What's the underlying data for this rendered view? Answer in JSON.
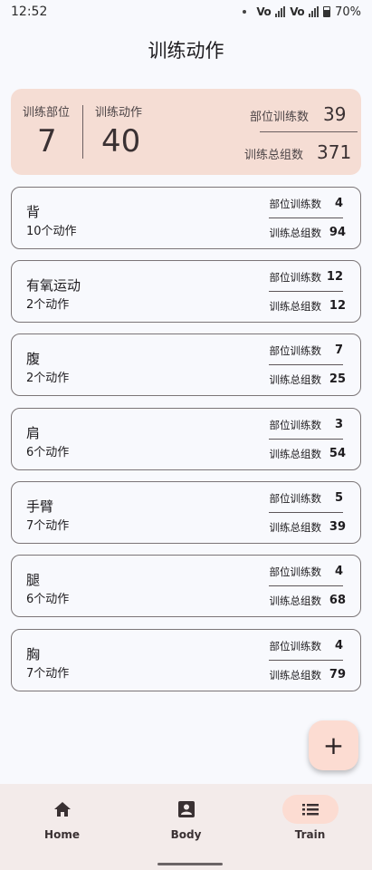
{
  "status_bar": {
    "time": "12:52",
    "volte1": "Vo",
    "volte2": "Vo",
    "battery_percent": "70%"
  },
  "header": {
    "title": "训练动作"
  },
  "summary": {
    "parts_label": "训练部位",
    "parts_value": "7",
    "actions_label": "训练动作",
    "actions_value": "40",
    "part_trainings_label": "部位训练数",
    "part_trainings_value": "39",
    "total_sets_label": "训练总组数",
    "total_sets_value": "371"
  },
  "labels": {
    "part_trainings": "部位训练数",
    "total_sets": "训练总组数"
  },
  "cards": [
    {
      "name": "背",
      "count": "10个动作",
      "part_trainings": "4",
      "total_sets": "94"
    },
    {
      "name": "有氧运动",
      "count": "2个动作",
      "part_trainings": "12",
      "total_sets": "12"
    },
    {
      "name": "腹",
      "count": "2个动作",
      "part_trainings": "7",
      "total_sets": "25"
    },
    {
      "name": "肩",
      "count": "6个动作",
      "part_trainings": "3",
      "total_sets": "54"
    },
    {
      "name": "手臂",
      "count": "7个动作",
      "part_trainings": "5",
      "total_sets": "39"
    },
    {
      "name": "腿",
      "count": "6个动作",
      "part_trainings": "4",
      "total_sets": "68"
    },
    {
      "name": "胸",
      "count": "7个动作",
      "part_trainings": "4",
      "total_sets": "79"
    }
  ],
  "fab": {
    "icon": "plus-icon",
    "label": "+"
  },
  "nav": {
    "items": [
      {
        "label": "Home",
        "icon": "home-icon"
      },
      {
        "label": "Body",
        "icon": "body-icon"
      },
      {
        "label": "Train",
        "icon": "list-icon"
      }
    ],
    "active_index": 2
  },
  "colors": {
    "background": "#f8f9fd",
    "summary_bg": "#f5ddd4",
    "accent": "#fcdcd2",
    "nav_bg": "#f3ebea"
  }
}
